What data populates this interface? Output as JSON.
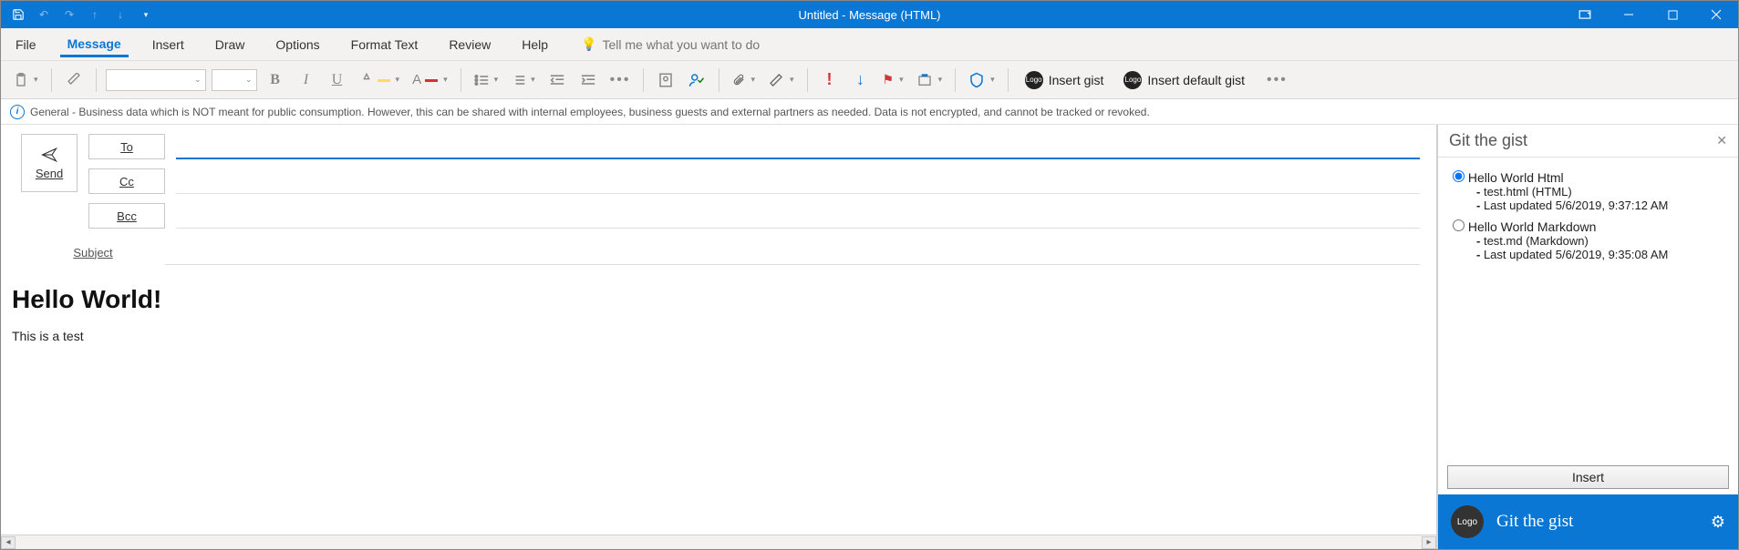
{
  "window": {
    "title": "Untitled  -  Message (HTML)"
  },
  "ribbon_tabs": {
    "file": "File",
    "message": "Message",
    "insert": "Insert",
    "draw": "Draw",
    "options": "Options",
    "format": "Format Text",
    "review": "Review",
    "help": "Help",
    "tellme_placeholder": "Tell me what you want to do"
  },
  "toolbar": {
    "insert_gist": "Insert gist",
    "insert_default_gist": "Insert default gist",
    "logo_text": "Logo"
  },
  "infobar": {
    "text": "General - Business data which is NOT meant for public consumption. However, this can be shared with internal employees, business guests and external partners as needed. Data is not encrypted, and cannot be tracked or revoked."
  },
  "compose": {
    "send": "Send",
    "to": "To",
    "cc": "Cc",
    "bcc": "Bcc",
    "subject": "Subject",
    "to_value": "",
    "cc_value": "",
    "bcc_value": "",
    "subject_value": "",
    "body_heading": "Hello World!",
    "body_text": "This is a test"
  },
  "pane": {
    "title": "Git the gist",
    "gists": [
      {
        "name": "Hello World Html",
        "file": "test.html (HTML)",
        "updated": "Last updated 5/6/2019, 9:37:12 AM",
        "selected": true
      },
      {
        "name": "Hello World Markdown",
        "file": "test.md (Markdown)",
        "updated": "Last updated 5/6/2019, 9:35:08 AM",
        "selected": false
      }
    ],
    "insert_button": "Insert",
    "footer_logo": "Logo",
    "footer_name": "Git the gist"
  }
}
